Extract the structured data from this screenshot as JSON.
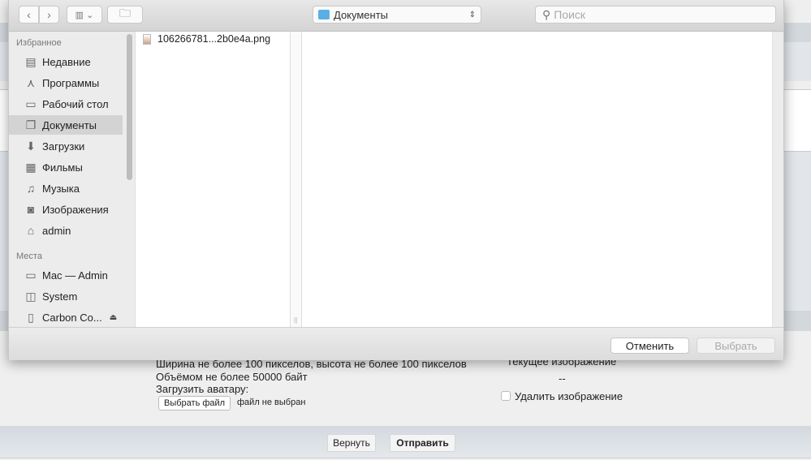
{
  "dialog": {
    "location": "Документы",
    "search_placeholder": "Поиск",
    "sidebar": {
      "favorites_header": "Избранное",
      "favorites": [
        {
          "label": "Недавние",
          "icon": "recents-icon"
        },
        {
          "label": "Программы",
          "icon": "applications-icon"
        },
        {
          "label": "Рабочий стол",
          "icon": "desktop-icon"
        },
        {
          "label": "Документы",
          "icon": "documents-icon",
          "selected": true
        },
        {
          "label": "Загрузки",
          "icon": "downloads-icon"
        },
        {
          "label": "Фильмы",
          "icon": "movies-icon"
        },
        {
          "label": "Музыка",
          "icon": "music-icon"
        },
        {
          "label": "Изображения",
          "icon": "pictures-icon"
        },
        {
          "label": "admin",
          "icon": "home-icon"
        }
      ],
      "places_header": "Места",
      "places": [
        {
          "label": "Mac — Admin",
          "icon": "computer-icon"
        },
        {
          "label": "System",
          "icon": "disk-icon"
        },
        {
          "label": "Carbon Co...",
          "icon": "external-drive-icon"
        }
      ]
    },
    "files": [
      {
        "name": "106266781...2b0e4a.png",
        "icon": "image-file-icon"
      }
    ],
    "cancel_label": "Отменить",
    "choose_label": "Выбрать"
  },
  "page": {
    "size_hint": "Ширина не более 100 пикселов, высота не более 100 пикселов",
    "weight_hint": "Объёмом не более 50000 байт",
    "upload_label": "Загрузить аватару:",
    "choose_file_label": "Выбрать файл",
    "no_file_label": "файл не выбран",
    "current_image_label": "Текущее изображение",
    "current_image_value": "--",
    "delete_image_label": "Удалить изображение",
    "delete_image_checked": false,
    "reset_label": "Вернуть",
    "submit_label": "Отправить"
  }
}
